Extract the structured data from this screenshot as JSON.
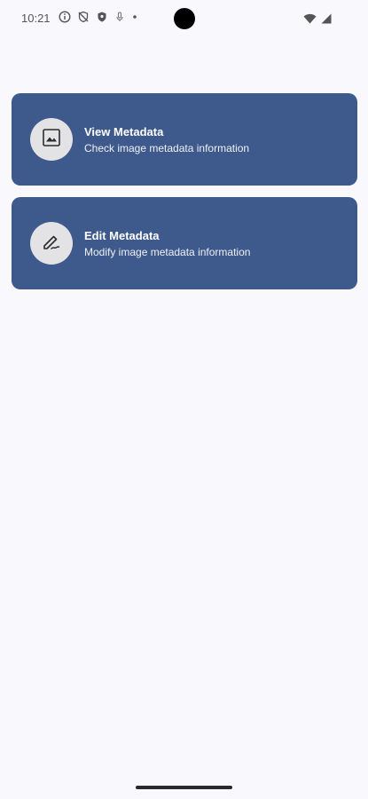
{
  "status_bar": {
    "time": "10:21",
    "icons_left": [
      "info-icon",
      "shield-off-icon",
      "shield-icon",
      "mic-off-icon",
      "dot-icon"
    ],
    "icons_right": [
      "wifi-icon",
      "signal-icon"
    ]
  },
  "cards": [
    {
      "title": "View Metadata",
      "subtitle": "Check image metadata information",
      "icon": "image-icon"
    },
    {
      "title": "Edit Metadata",
      "subtitle": "Modify image metadata information",
      "icon": "edit-pen-icon"
    }
  ],
  "colors": {
    "background": "#f8f8fd",
    "card": "#3e5a8c",
    "icon_circle": "#e3e3e6"
  }
}
